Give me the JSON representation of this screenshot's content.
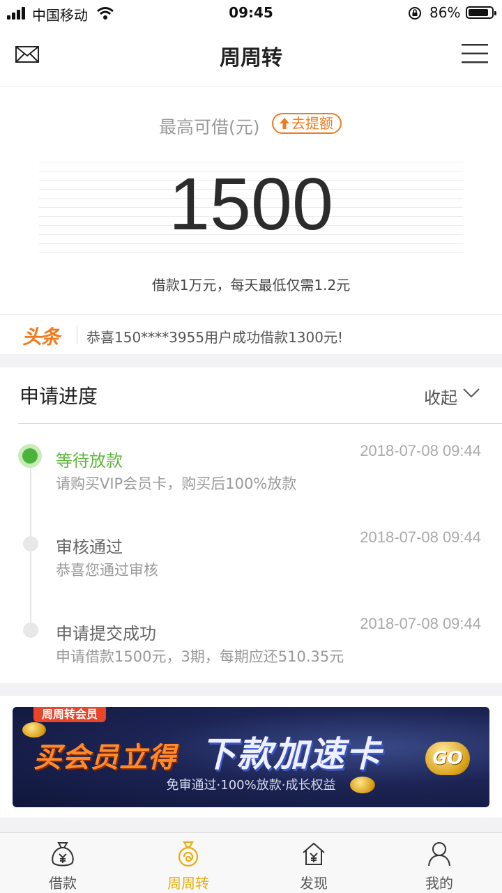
{
  "status_bar": {
    "carrier": "中国移动",
    "time": "09:45",
    "battery_percent": "86%",
    "battery_level": 0.86
  },
  "nav": {
    "title": "周周转",
    "left_icon": "mail-icon",
    "right_icon": "menu-icon"
  },
  "credit": {
    "label": "最高可借(元)",
    "raise_button": "去提额",
    "amount": "1500",
    "note": "借款1万元，每天最低仅需1.2元"
  },
  "ticker": {
    "logo_text": "头条",
    "message": "恭喜150****3955用户成功借款1300元!"
  },
  "progress": {
    "title": "申请进度",
    "collapse_label": "收起",
    "steps": [
      {
        "title": "等待放款",
        "desc": "请购买VIP会员卡，购买后100%放款",
        "time": "2018-07-08 09:44",
        "active": true
      },
      {
        "title": "审核通过",
        "desc": "恭喜您通过审核",
        "time": "2018-07-08 09:44",
        "active": false
      },
      {
        "title": "申请提交成功",
        "desc": "申请借款1500元，3期，每期应还510.35元",
        "time": "2018-07-08 09:44",
        "active": false
      }
    ]
  },
  "banner": {
    "tag": "周周转会员",
    "headline_left": "买会员立得",
    "headline_right": "下款加速卡",
    "subtitle": "免审通过·100%放款·成长权益",
    "go_label": "GO"
  },
  "tabbar": {
    "items": [
      {
        "label": "借款",
        "icon": "money-bag-icon",
        "active": false
      },
      {
        "label": "周周转",
        "icon": "coin-swirl-icon",
        "active": true
      },
      {
        "label": "发现",
        "icon": "home-yen-icon",
        "active": false
      },
      {
        "label": "我的",
        "icon": "user-icon",
        "active": false
      }
    ]
  },
  "colors": {
    "accent_orange": "#f07b1d",
    "active_green": "#5cb83b",
    "tab_active": "#e9ac12"
  }
}
